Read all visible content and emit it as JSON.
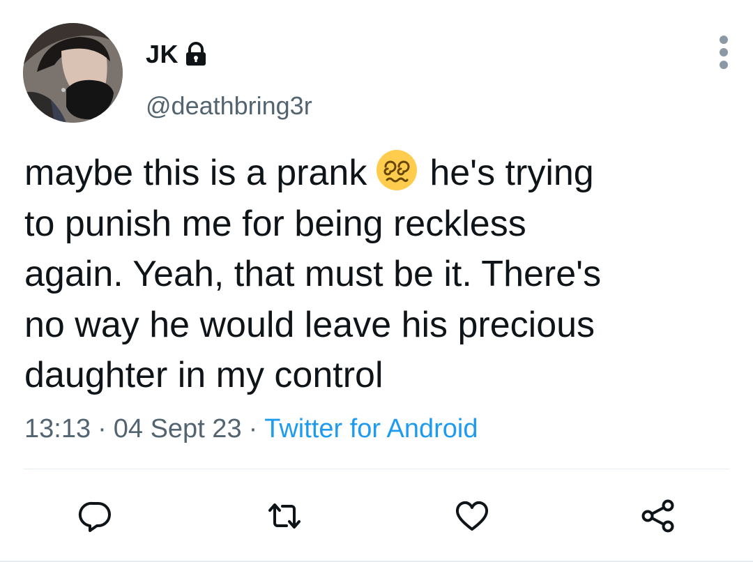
{
  "author": {
    "display_name": "JK",
    "handle": "@deathbring3r",
    "avatar_icon": "profile-photo",
    "protected_icon": "lock-icon"
  },
  "tweet": {
    "lines": [
      {
        "before": "maybe this is a prank",
        "emoji": "dizzy-face-emoji",
        "after": "he's trying"
      },
      {
        "text": "to punish me for being reckless"
      },
      {
        "text": "again. Yeah, that must be it. There's"
      },
      {
        "text": "no way he would leave his precious"
      },
      {
        "text": "daughter in my control"
      }
    ]
  },
  "meta": {
    "time": "13:13",
    "separator": "·",
    "date": "04 Sept 23",
    "source": "Twitter for Android"
  },
  "actions": {
    "reply_icon": "reply-icon",
    "retweet_icon": "retweet-icon",
    "like_icon": "like-icon",
    "share_icon": "share-icon"
  },
  "colors": {
    "text": "#0f1419",
    "secondary": "#536471",
    "link": "#1d9bf0",
    "divider": "#e6ecf0"
  }
}
